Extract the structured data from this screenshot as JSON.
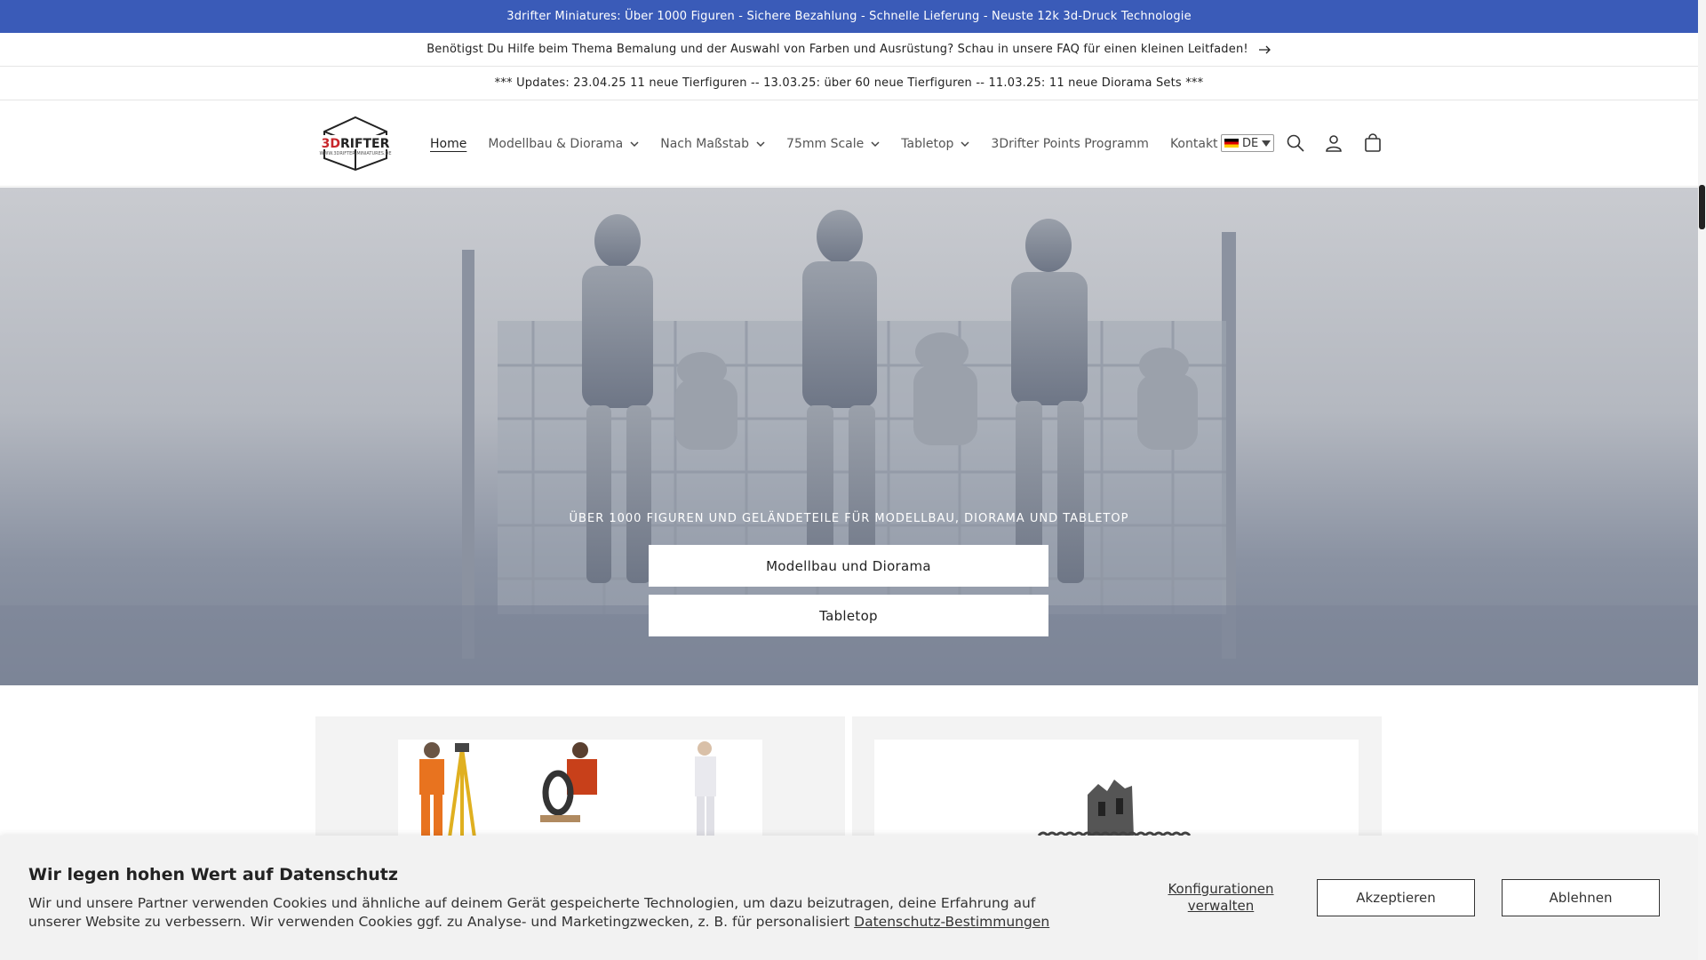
{
  "announcements": {
    "top": "3drifter Miniatures: Über 1000 Figuren - Sichere Bezahlung - Schnelle Lieferung - Neuste 12k 3d-Druck Technologie",
    "faq": "Benötigst Du Hilfe beim Thema Bemalung und der Auswahl von Farben und Ausrüstung? Schau in unsere FAQ für einen kleinen Leitfaden!",
    "updates": "*** Updates: 23.04.25 11 neue Tierfiguren -- 13.03.25: über 60 neue Tierfiguren -- 11.03.25: 11 neue Diorama Sets ***"
  },
  "header": {
    "logo_main_a": "3D",
    "logo_main_b": "RIFTER",
    "logo_sub": "WWW.3DRIFTER-MINIATURES.DE",
    "nav": [
      {
        "label": "Home",
        "active": true,
        "dropdown": false
      },
      {
        "label": "Modellbau & Diorama",
        "dropdown": true
      },
      {
        "label": "Nach Maßstab",
        "dropdown": true
      },
      {
        "label": "75mm Scale",
        "dropdown": true
      },
      {
        "label": "Tabletop",
        "dropdown": true
      },
      {
        "label": "3Drifter Points Programm",
        "dropdown": false
      },
      {
        "label": "Kontakt",
        "dropdown": false
      }
    ],
    "language": "DE",
    "icons": [
      "search-icon",
      "account-icon",
      "cart-icon"
    ]
  },
  "hero": {
    "caption": "ÜBER 1000 FIGUREN UND GELÄNDETEILE FÜR MODELLBAU, DIORAMA UND TABLETOP",
    "button_1": "Modellbau und Diorama",
    "button_2": "Tabletop"
  },
  "cookie": {
    "title": "Wir legen hohen Wert auf Datenschutz",
    "text": "Wir und unsere Partner verwenden Cookies und ähnliche auf deinem Gerät gespeicherte Technologien, um dazu beizutragen, deine Erfahrung auf unserer Website zu verbessern. Wir verwenden Cookies ggf. zu Analyse- und Marketingzwecken, z. B. für personalisiert",
    "link": "Datenschutz-Bestimmungen",
    "config_line1": "Konfigurationen",
    "config_line2": "verwalten",
    "accept": "Akzeptieren",
    "reject": "Ablehnen"
  },
  "colors": {
    "announcement_bg": "#3a5bb8",
    "logo_red": "#c8262b"
  }
}
